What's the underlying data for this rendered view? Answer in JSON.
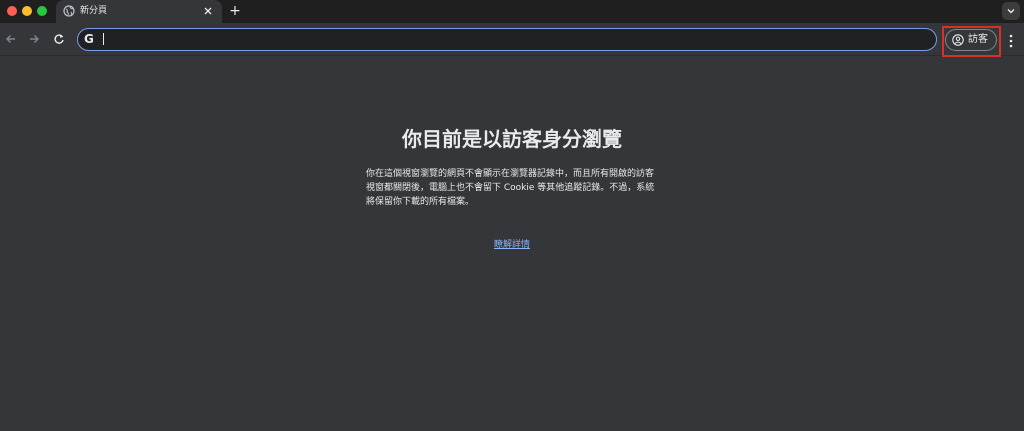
{
  "tab": {
    "title": "新分頁",
    "icon": "globe-icon"
  },
  "toolbar": {
    "new_tab_label": "+",
    "address_value": "",
    "google_mark": "G",
    "profile_label": "訪客"
  },
  "content": {
    "title": "你目前是以訪客身分瀏覽",
    "description": "你在這個視窗瀏覽的網頁不會顯示在瀏覽器記錄中，而且所有開啟的訪客視窗都關閉後，電腦上也不會留下 Cookie 等其他追蹤記錄。不過，系統將保留你下載的所有檔案。",
    "learn_more": "瞭解詳情"
  },
  "colors": {
    "background": "#35363a",
    "tabstrip": "#1f1f1f",
    "omnibox_border": "#7c9ce8",
    "link": "#8ab4f8",
    "highlight": "#d93025"
  }
}
